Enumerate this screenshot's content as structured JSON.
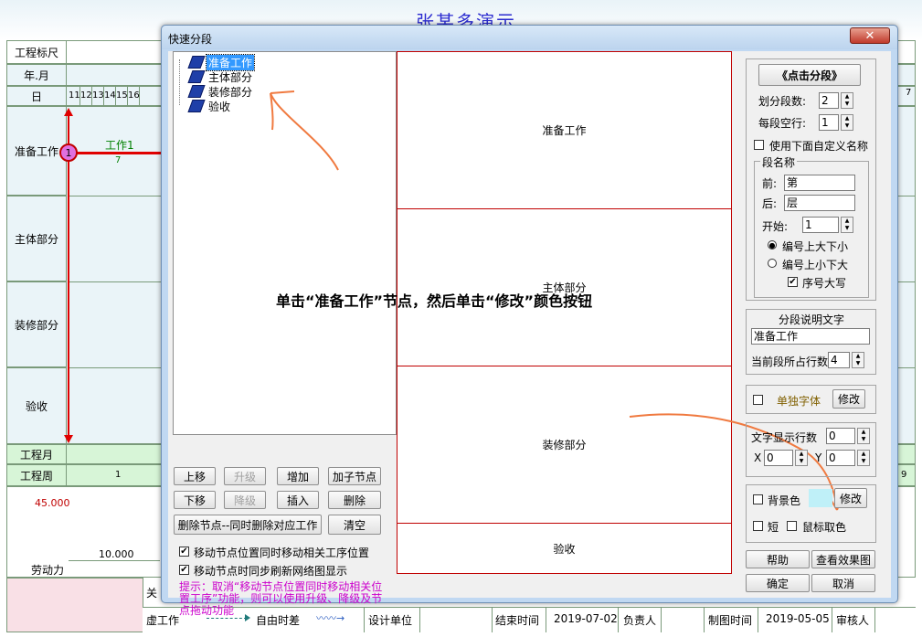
{
  "background": {
    "title": "张某多演示",
    "labels": {
      "gcbc": "工程标尺",
      "ny": "年.月",
      "ri": "日",
      "gcy": "工程月",
      "gcz": "工程周",
      "ldl": "劳动力"
    },
    "rows": [
      "准备工作",
      "主体部分",
      "装修部分",
      "验收"
    ],
    "days": [
      "11",
      "12",
      "13",
      "14",
      "15",
      "16"
    ],
    "task_name": "工作1",
    "task_duration": "7",
    "node_number": "1",
    "right_marker": "7",
    "week_first": "1",
    "week_right": "9",
    "labor_top": "45.000",
    "labor_mid": "10.000",
    "legend": {
      "xugongzuo": "虚工作",
      "ziyoushicha": "自由时差",
      "sheji": "设计单位",
      "jieshu": "结束时间",
      "jieshu_val": "2019-07-02",
      "fuze": "负责人",
      "zhitu": "制图时间",
      "zhitu_val": "2019-05-05",
      "shenhe": "审核人",
      "guan": "关"
    }
  },
  "dialog": {
    "title": "快速分段",
    "close": "✕",
    "tree": [
      "准备工作",
      "主体部分",
      "装修部分",
      "验收"
    ],
    "buttons": {
      "up": "上移",
      "upgrade": "升级",
      "add": "增加",
      "add_child": "加子节点",
      "down": "下移",
      "downgrade": "降级",
      "insert": "插入",
      "delete": "删除",
      "delete_node_also": "删除节点--同时删除对应工作",
      "clear": "清空"
    },
    "checks": {
      "move_pos": "移动节点位置同时移动相关工序位置",
      "sync_refresh": "移动节点时同步刷新网络图显示"
    },
    "hint": "提示：取消“移动节点位置同时移动相关位置工序”功能，则可以使用升级、降级及节点拖动功能",
    "preview_segments": [
      "准备工作",
      "主体部分",
      "装修部分",
      "验收"
    ],
    "instruction": "单击“准备工作”节点，然后单击“修改”颜色按钮",
    "right": {
      "click_segment": "《点击分段》",
      "seg_count_label": "划分段数:",
      "seg_count": "2",
      "seg_empty_label": "每段空行:",
      "seg_empty": "1",
      "use_custom": "使用下面自定义名称",
      "seg_name_group": "段名称",
      "prefix_label": "前:",
      "prefix": "第",
      "suffix_label": "后:",
      "suffix": "层",
      "start_label": "开始:",
      "start": "1",
      "radio1": "编号上大下小",
      "radio2": "编号上小下大",
      "upper": "序号大写",
      "desc_group": "分段说明文字",
      "desc": "准备工作",
      "rows_label": "当前段所占行数",
      "rows_val": "4",
      "single_font": "单独字体",
      "modify": "修改",
      "text_rows_label": "文字显示行数",
      "text_rows": "0",
      "x_label": "X",
      "x_val": "0",
      "y_label": "Y",
      "y_val": "0",
      "bg_color": "背景色",
      "short": "短",
      "mouse_color": "鼠标取色",
      "help": "帮助",
      "view_effect": "查看效果图",
      "ok": "确定",
      "cancel": "取消"
    },
    "colors": {
      "swatch": "#bff0f8",
      "single_font": "#806000"
    }
  }
}
